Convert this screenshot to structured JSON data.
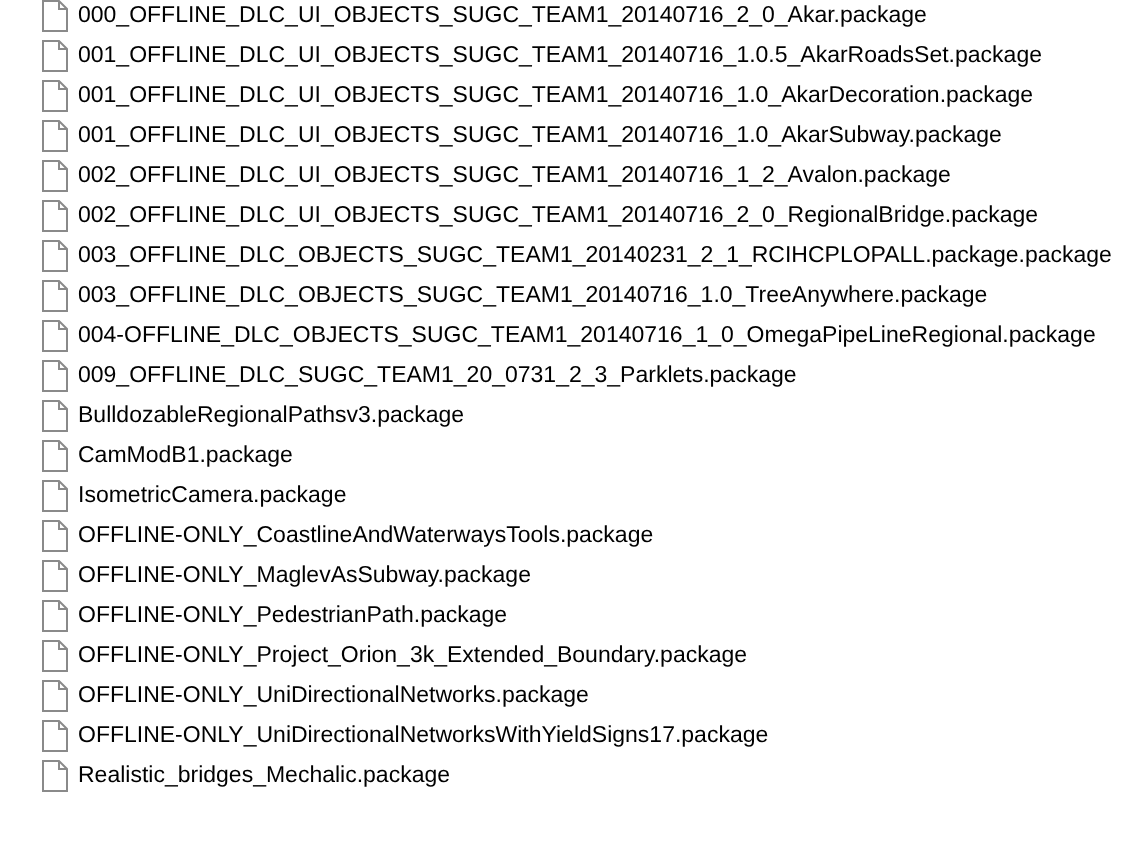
{
  "files": [
    {
      "name": "000_OFFLINE_DLC_UI_OBJECTS_SUGC_TEAM1_20140716_2_0_Akar.package"
    },
    {
      "name": "001_OFFLINE_DLC_UI_OBJECTS_SUGC_TEAM1_20140716_1.0.5_AkarRoadsSet.package"
    },
    {
      "name": "001_OFFLINE_DLC_UI_OBJECTS_SUGC_TEAM1_20140716_1.0_AkarDecoration.package"
    },
    {
      "name": "001_OFFLINE_DLC_UI_OBJECTS_SUGC_TEAM1_20140716_1.0_AkarSubway.package"
    },
    {
      "name": "002_OFFLINE_DLC_UI_OBJECTS_SUGC_TEAM1_20140716_1_2_Avalon.package"
    },
    {
      "name": "002_OFFLINE_DLC_UI_OBJECTS_SUGC_TEAM1_20140716_2_0_RegionalBridge.package"
    },
    {
      "name": "003_OFFLINE_DLC_OBJECTS_SUGC_TEAM1_20140231_2_1_RCIHCPLOPALL.package.package"
    },
    {
      "name": "003_OFFLINE_DLC_OBJECTS_SUGC_TEAM1_20140716_1.0_TreeAnywhere.package"
    },
    {
      "name": "004-OFFLINE_DLC_OBJECTS_SUGC_TEAM1_20140716_1_0_OmegaPipeLineRegional.package"
    },
    {
      "name": "009_OFFLINE_DLC_SUGC_TEAM1_20_0731_2_3_Parklets.package"
    },
    {
      "name": "BulldozableRegionalPathsv3.package"
    },
    {
      "name": "CamModB1.package"
    },
    {
      "name": "IsometricCamera.package"
    },
    {
      "name": "OFFLINE-ONLY_CoastlineAndWaterwaysTools.package"
    },
    {
      "name": "OFFLINE-ONLY_MaglevAsSubway.package"
    },
    {
      "name": "OFFLINE-ONLY_PedestrianPath.package"
    },
    {
      "name": "OFFLINE-ONLY_Project_Orion_3k_Extended_Boundary.package"
    },
    {
      "name": "OFFLINE-ONLY_UniDirectionalNetworks.package"
    },
    {
      "name": "OFFLINE-ONLY_UniDirectionalNetworksWithYieldSigns17.package"
    },
    {
      "name": "Realistic_bridges_Mechalic.package"
    }
  ]
}
